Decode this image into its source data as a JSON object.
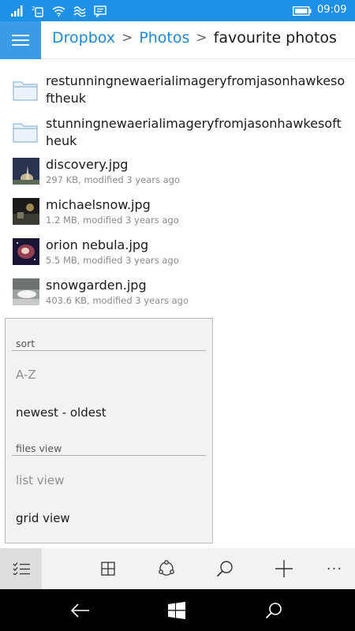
{
  "status_bar": {
    "time": "09:09",
    "icons": [
      "signal-icon",
      "sim-icon",
      "wifi-icon",
      "nfc-icon",
      "message-icon",
      "battery-icon"
    ]
  },
  "header": {
    "menu_icon": "hamburger-icon",
    "breadcrumb": {
      "root": "Dropbox",
      "parent": "Photos",
      "current": "favourite photos",
      "separator": ">"
    }
  },
  "files": [
    {
      "type": "folder",
      "name": "restunningnewaerialimageryfromjasonhawkesoftheuk",
      "meta": ""
    },
    {
      "type": "folder",
      "name": "stunningnewaerialimageryfromjasonhawkesoftheuk",
      "meta": ""
    },
    {
      "type": "image",
      "name": "discovery.jpg",
      "meta": "297 KB, modified 3 years ago"
    },
    {
      "type": "image",
      "name": "michaelsnow.jpg",
      "meta": "1.2 MB, modified 3 years ago"
    },
    {
      "type": "image",
      "name": "orion nebula.jpg",
      "meta": "5.5 MB, modified 3 years ago"
    },
    {
      "type": "image",
      "name": "snowgarden.jpg",
      "meta": "403.6 KB, modified 3 years ago"
    }
  ],
  "menu": {
    "sort_header": "sort",
    "sort_az": "A-Z",
    "sort_newest": "newest - oldest",
    "view_header": "files view",
    "view_list": "list view",
    "view_grid": "grid view"
  },
  "app_bar": {
    "icons": [
      "select-list-icon",
      "grid-icon",
      "share-icon",
      "search-icon",
      "add-icon",
      "more-icon"
    ],
    "more_label": "···"
  },
  "nav_bar": {
    "icons": [
      "back-icon",
      "windows-icon",
      "search-icon"
    ]
  },
  "colors": {
    "accent": "#1e90e8",
    "link": "#1e88d8",
    "menu_bg": "#f2f2f2",
    "nav_bg": "#000000"
  }
}
